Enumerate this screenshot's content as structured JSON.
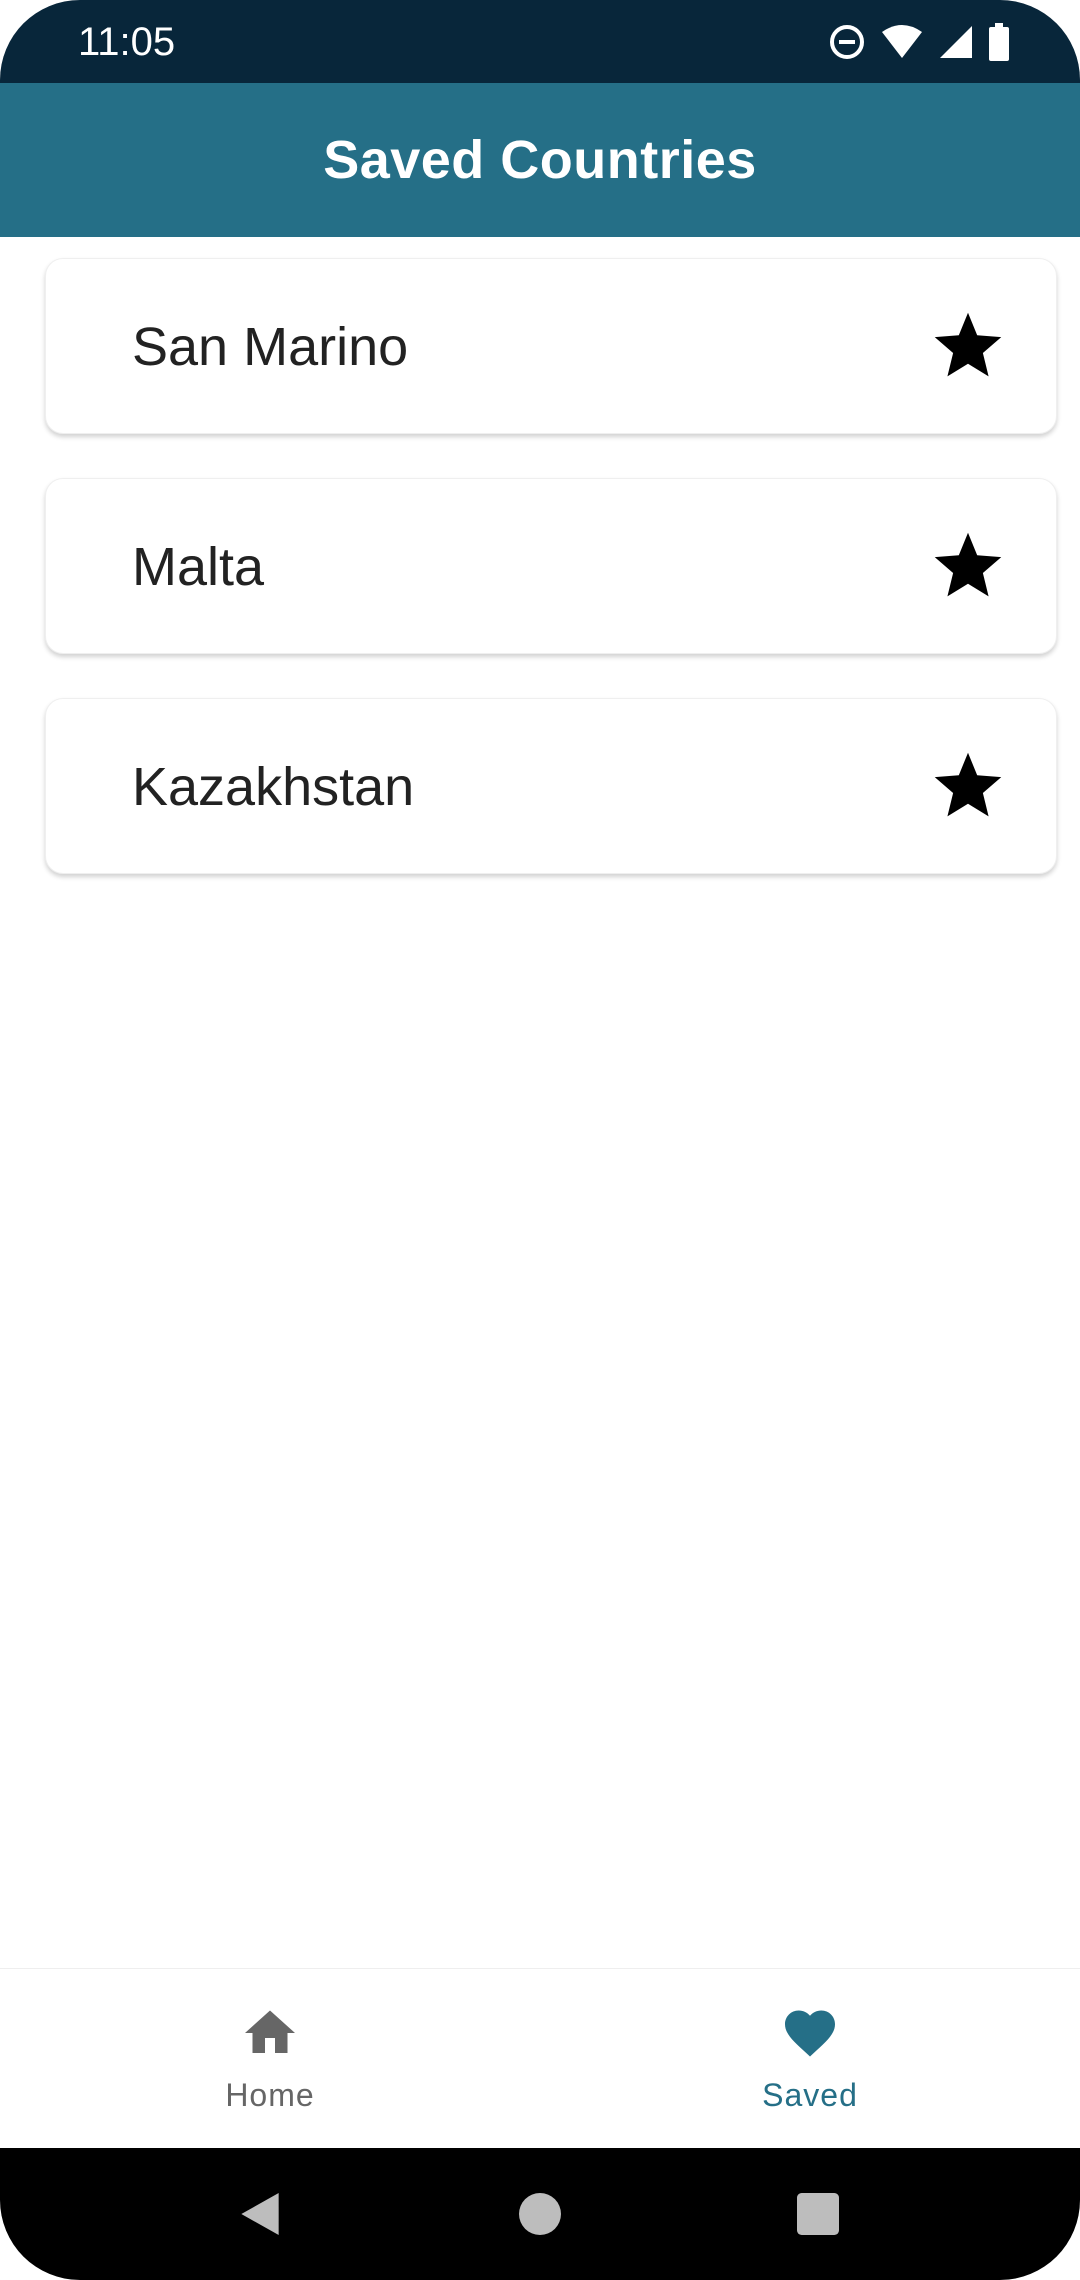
{
  "status_bar": {
    "time": "11:05",
    "icons": [
      "do-not-disturb-icon",
      "wifi-icon",
      "signal-icon",
      "battery-icon"
    ]
  },
  "app_bar": {
    "title": "Saved Countries",
    "color": "#256f87"
  },
  "saved_countries": [
    {
      "name": "San Marino",
      "icon": "star-icon"
    },
    {
      "name": "Malta",
      "icon": "star-icon"
    },
    {
      "name": "Kazakhstan",
      "icon": "star-icon"
    }
  ],
  "bottom_nav": {
    "items": [
      {
        "label": "Home",
        "icon": "home-icon",
        "selected": false
      },
      {
        "label": "Saved",
        "icon": "heart-icon",
        "selected": true
      }
    ],
    "active_color": "#256f87"
  },
  "system_nav": {
    "buttons": [
      "back-icon",
      "home-circle-icon",
      "recents-icon"
    ]
  }
}
